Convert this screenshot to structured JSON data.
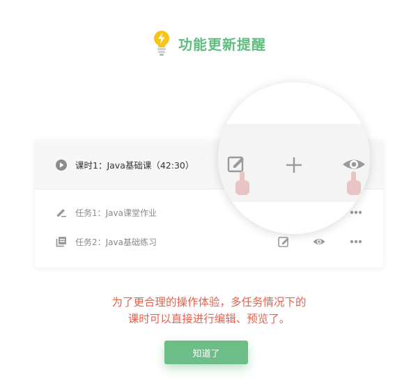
{
  "header": {
    "title": "功能更新提醒",
    "icon": "lightbulb-icon",
    "title_color": "#5fbd7e",
    "bulb_color": "#f5c518"
  },
  "list": {
    "lesson": {
      "label": "课时1：Java基础课（42:30）",
      "icon": "play-circle-icon"
    },
    "tasks": [
      {
        "label": "任务1：Java课堂作业",
        "icon": "pen-icon",
        "actions": [
          "more-icon"
        ]
      },
      {
        "label": "任务2：Java基础练习",
        "icon": "library-icon",
        "actions": [
          "edit-icon",
          "eye-icon",
          "more-icon"
        ]
      }
    ]
  },
  "magnifier": {
    "icons": [
      "edit-icon",
      "plus-icon",
      "eye-icon"
    ],
    "pointer_icons": [
      "hand-pointer-icon",
      "hand-pointer-icon"
    ],
    "pointer_color": "#e8c4c4"
  },
  "message": {
    "line1": "为了更合理的操作体验，多任务情况下的",
    "line2": "课时可以直接进行编辑、预览了。",
    "color": "#e8604c"
  },
  "button": {
    "label": "知道了",
    "color": "#6cbd87"
  }
}
